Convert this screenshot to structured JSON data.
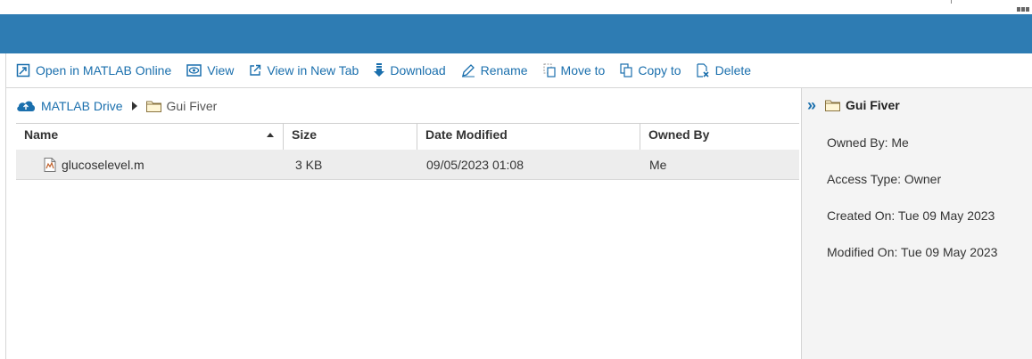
{
  "toolbar": {
    "open_online": "Open in MATLAB Online",
    "view": "View",
    "view_new_tab": "View in New Tab",
    "download": "Download",
    "rename": "Rename",
    "move_to": "Move to",
    "copy_to": "Copy to",
    "delete": "Delete"
  },
  "breadcrumb": {
    "root": "MATLAB Drive",
    "current": "Gui Fiver"
  },
  "table": {
    "columns": [
      "Name",
      "Size",
      "Date Modified",
      "Owned By"
    ],
    "rows": [
      {
        "name": "glucoselevel.m",
        "size": "3 KB",
        "date": "09/05/2023 01:08",
        "owner": "Me"
      }
    ]
  },
  "details": {
    "title": "Gui Fiver",
    "owned_by": "Owned By: Me",
    "access_type": "Access Type: Owner",
    "created_on": "Created On: Tue 09 May 2023",
    "modified_on": "Modified On: Tue 09 May 2023"
  },
  "colors": {
    "banner": "#2e7cb3",
    "link": "#1a6fad",
    "row_selected": "#ededed",
    "panel": "#f4f4f4"
  }
}
